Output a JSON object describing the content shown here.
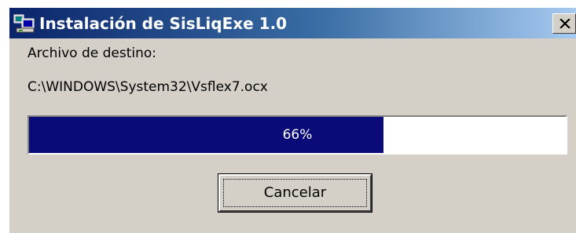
{
  "window": {
    "title": "Instalación de SisLiqExe 1.0",
    "close_icon": "close-icon",
    "app_icon": "installer-computer-icon"
  },
  "body": {
    "destination_label": "Archivo de destino:",
    "destination_path": "C:\\WINDOWS\\System32\\Vsflex7.ocx"
  },
  "progress": {
    "percent": 66,
    "label": "66%"
  },
  "buttons": {
    "cancel_label": "Cancelar"
  },
  "colors": {
    "progress_fill": "#0a0a78",
    "title_bar_start": "#0a246a",
    "title_bar_end": "#a6caf0",
    "dialog_background": "#d4d0c8"
  }
}
